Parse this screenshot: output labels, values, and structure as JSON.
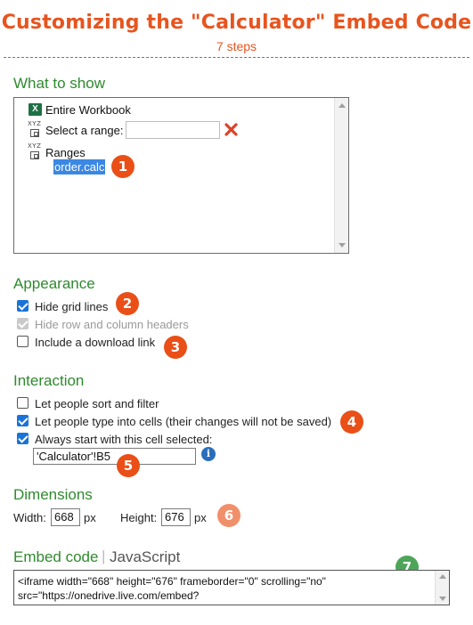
{
  "header": {
    "title": "Customizing the \"Calculator\" Embed Code",
    "subtitle": "7 steps"
  },
  "what_to_show": {
    "heading": "What to show",
    "items": {
      "entire_workbook": "Entire Workbook",
      "select_range": "Select a range:",
      "select_range_value": "",
      "ranges": "Ranges",
      "selected_range": "order.calc"
    }
  },
  "appearance": {
    "heading": "Appearance",
    "hide_grid_lines": "Hide grid lines",
    "hide_headers": "Hide row and column headers",
    "include_download": "Include a download link"
  },
  "interaction": {
    "heading": "Interaction",
    "sort_filter": "Let people sort and filter",
    "type_cells": "Let people type into cells (their changes will not be saved)",
    "start_cell": "Always start with this cell selected:",
    "start_cell_value": "'Calculator'!B5"
  },
  "dimensions": {
    "heading": "Dimensions",
    "width_label": "Width:",
    "width_value": "668",
    "height_label": "Height:",
    "height_value": "676",
    "unit": "px"
  },
  "embed": {
    "heading": "Embed code",
    "separator": "|",
    "alt_tab": "JavaScript",
    "code": "<iframe width=\"668\" height=\"676\" frameborder=\"0\" scrolling=\"no\" src=\"https://onedrive.live.com/embed?"
  },
  "steps": [
    "1",
    "2",
    "3",
    "4",
    "5",
    "6",
    "7"
  ],
  "icons": {
    "excel": "X",
    "clear": "close-icon",
    "info": "i"
  },
  "colors": {
    "accent": "#e8541e",
    "section": "#2f8a2f",
    "badge": "#ea4f17",
    "badge_soft": "#f0906b",
    "badge_green": "#4ea55a",
    "selection": "#3b87e4",
    "checkbox": "#1a73d8"
  }
}
